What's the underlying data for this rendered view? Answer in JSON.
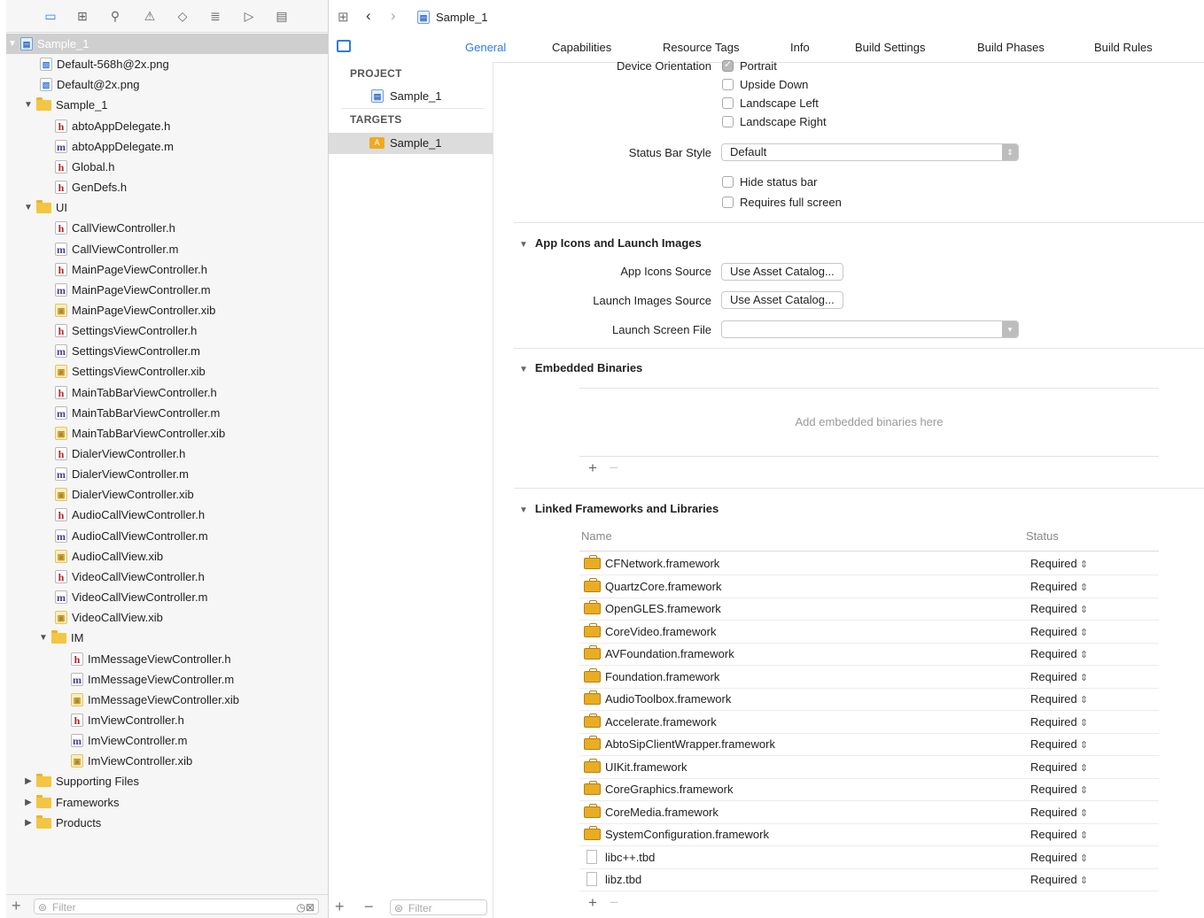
{
  "jumpbar": {
    "project_name": "Sample_1"
  },
  "navigator": {
    "filter_placeholder": "Filter",
    "tree": [
      {
        "label": "Sample_1",
        "type": "proj",
        "level": 0,
        "disclosure": "open",
        "selected": true
      },
      {
        "label": "Default-568h@2x.png",
        "type": "png",
        "level": 1
      },
      {
        "label": "Default@2x.png",
        "type": "png",
        "level": 1
      },
      {
        "label": "Sample_1",
        "type": "folder",
        "level": 1,
        "disclosure": "open"
      },
      {
        "label": "abtoAppDelegate.h",
        "type": "h",
        "level": 2
      },
      {
        "label": "abtoAppDelegate.m",
        "type": "m",
        "level": 2
      },
      {
        "label": "Global.h",
        "type": "h",
        "level": 2
      },
      {
        "label": "GenDefs.h",
        "type": "h",
        "level": 2
      },
      {
        "label": "UI",
        "type": "folder",
        "level": 1,
        "disclosure": "open"
      },
      {
        "label": "CallViewController.h",
        "type": "h",
        "level": 2
      },
      {
        "label": "CallViewController.m",
        "type": "m",
        "level": 2
      },
      {
        "label": "MainPageViewController.h",
        "type": "h",
        "level": 2
      },
      {
        "label": "MainPageViewController.m",
        "type": "m",
        "level": 2
      },
      {
        "label": "MainPageViewController.xib",
        "type": "xib",
        "level": 2
      },
      {
        "label": "SettingsViewController.h",
        "type": "h",
        "level": 2
      },
      {
        "label": "SettingsViewController.m",
        "type": "m",
        "level": 2
      },
      {
        "label": "SettingsViewController.xib",
        "type": "xib",
        "level": 2
      },
      {
        "label": "MainTabBarViewController.h",
        "type": "h",
        "level": 2
      },
      {
        "label": "MainTabBarViewController.m",
        "type": "m",
        "level": 2
      },
      {
        "label": "MainTabBarViewController.xib",
        "type": "xib",
        "level": 2
      },
      {
        "label": "DialerViewController.h",
        "type": "h",
        "level": 2
      },
      {
        "label": "DialerViewController.m",
        "type": "m",
        "level": 2
      },
      {
        "label": "DialerViewController.xib",
        "type": "xib",
        "level": 2
      },
      {
        "label": "AudioCallViewController.h",
        "type": "h",
        "level": 2
      },
      {
        "label": "AudioCallViewController.m",
        "type": "m",
        "level": 2
      },
      {
        "label": "AudioCallView.xib",
        "type": "xib",
        "level": 2
      },
      {
        "label": "VideoCallViewController.h",
        "type": "h",
        "level": 2
      },
      {
        "label": "VideoCallViewController.m",
        "type": "m",
        "level": 2
      },
      {
        "label": "VideoCallView.xib",
        "type": "xib",
        "level": 2
      },
      {
        "label": "IM",
        "type": "folder",
        "level": 2,
        "disclosure": "open"
      },
      {
        "label": "ImMessageViewController.h",
        "type": "h",
        "level": 3
      },
      {
        "label": "ImMessageViewController.m",
        "type": "m",
        "level": 3
      },
      {
        "label": "ImMessageViewController.xib",
        "type": "xib",
        "level": 3
      },
      {
        "label": "ImViewController.h",
        "type": "h",
        "level": 3
      },
      {
        "label": "ImViewController.m",
        "type": "m",
        "level": 3
      },
      {
        "label": "ImViewController.xib",
        "type": "xib",
        "level": 3
      },
      {
        "label": "Supporting Files",
        "type": "folder",
        "level": 1,
        "disclosure": "closed"
      },
      {
        "label": "Frameworks",
        "type": "folder",
        "level": 1,
        "disclosure": "closed"
      },
      {
        "label": "Products",
        "type": "folder",
        "level": 1,
        "disclosure": "closed"
      }
    ]
  },
  "targets_panel": {
    "project_header": "PROJECT",
    "project_item": "Sample_1",
    "targets_header": "TARGETS",
    "target_item": "Sample_1",
    "filter_placeholder": "Filter"
  },
  "tabs": [
    "General",
    "Capabilities",
    "Resource Tags",
    "Info",
    "Build Settings",
    "Build Phases",
    "Build Rules"
  ],
  "active_tab": "General",
  "deployment": {
    "device_orientation_label": "Device Orientation",
    "orientations": [
      {
        "label": "Portrait",
        "checked": true
      },
      {
        "label": "Upside Down",
        "checked": false
      },
      {
        "label": "Landscape Left",
        "checked": false
      },
      {
        "label": "Landscape Right",
        "checked": false
      }
    ],
    "status_bar_style_label": "Status Bar Style",
    "status_bar_style_value": "Default",
    "hide_status_bar": "Hide status bar",
    "requires_full_screen": "Requires full screen"
  },
  "app_icons": {
    "title": "App Icons and Launch Images",
    "app_icons_source_label": "App Icons Source",
    "app_icons_source_button": "Use Asset Catalog...",
    "launch_images_source_label": "Launch Images Source",
    "launch_images_source_button": "Use Asset Catalog...",
    "launch_screen_file_label": "Launch Screen File",
    "launch_screen_file_value": ""
  },
  "embedded": {
    "title": "Embedded Binaries",
    "placeholder": "Add embedded binaries here"
  },
  "linked": {
    "title": "Linked Frameworks and Libraries",
    "col_name": "Name",
    "col_status": "Status",
    "rows": [
      {
        "name": "CFNetwork.framework",
        "status": "Required",
        "kind": "framework"
      },
      {
        "name": "QuartzCore.framework",
        "status": "Required",
        "kind": "framework"
      },
      {
        "name": "OpenGLES.framework",
        "status": "Required",
        "kind": "framework"
      },
      {
        "name": "CoreVideo.framework",
        "status": "Required",
        "kind": "framework"
      },
      {
        "name": "AVFoundation.framework",
        "status": "Required",
        "kind": "framework"
      },
      {
        "name": "Foundation.framework",
        "status": "Required",
        "kind": "framework"
      },
      {
        "name": "AudioToolbox.framework",
        "status": "Required",
        "kind": "framework"
      },
      {
        "name": "Accelerate.framework",
        "status": "Required",
        "kind": "framework"
      },
      {
        "name": "AbtoSipClientWrapper.framework",
        "status": "Required",
        "kind": "framework"
      },
      {
        "name": "UIKit.framework",
        "status": "Required",
        "kind": "framework"
      },
      {
        "name": "CoreGraphics.framework",
        "status": "Required",
        "kind": "framework"
      },
      {
        "name": "CoreMedia.framework",
        "status": "Required",
        "kind": "framework"
      },
      {
        "name": "SystemConfiguration.framework",
        "status": "Required",
        "kind": "framework"
      },
      {
        "name": "libc++.tbd",
        "status": "Required",
        "kind": "tbd"
      },
      {
        "name": "libz.tbd",
        "status": "Required",
        "kind": "tbd"
      }
    ]
  },
  "colors": {
    "accent": "#2f7ae5",
    "selection": "#cfcfcf",
    "folder": "#f4c542"
  }
}
